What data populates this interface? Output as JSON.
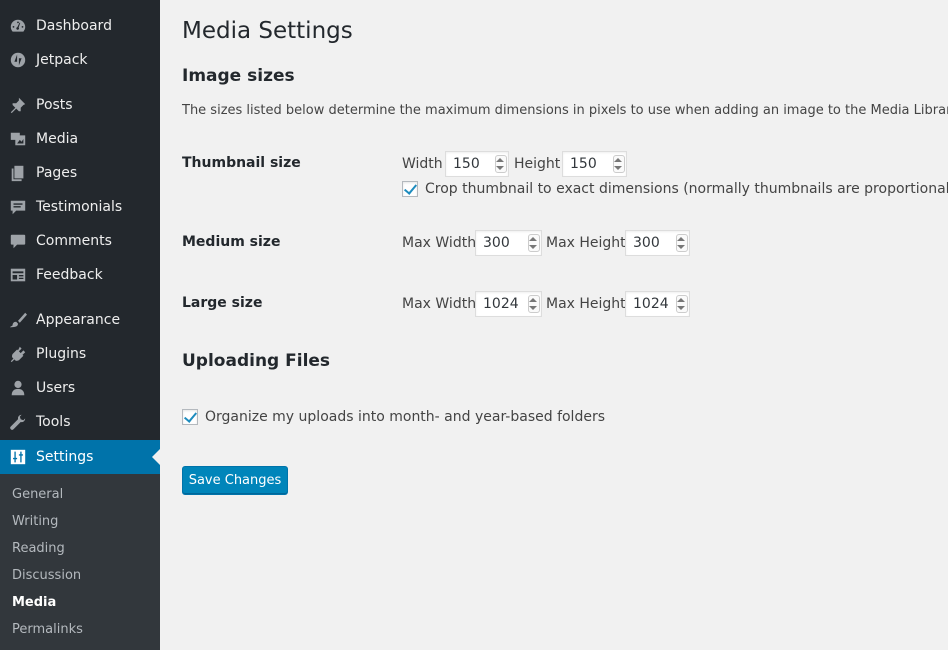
{
  "sidebar": {
    "items": [
      {
        "label": "Dashboard",
        "icon": "dashboard-icon"
      },
      {
        "label": "Jetpack",
        "icon": "jetpack-icon"
      },
      {
        "label": "Posts",
        "icon": "pushpin-icon"
      },
      {
        "label": "Media",
        "icon": "media-icon"
      },
      {
        "label": "Pages",
        "icon": "pages-icon"
      },
      {
        "label": "Testimonials",
        "icon": "testimonials-icon"
      },
      {
        "label": "Comments",
        "icon": "comment-bubble-icon"
      },
      {
        "label": "Feedback",
        "icon": "feedback-icon"
      },
      {
        "label": "Appearance",
        "icon": "paintbrush-icon"
      },
      {
        "label": "Plugins",
        "icon": "plug-icon"
      },
      {
        "label": "Users",
        "icon": "user-icon"
      },
      {
        "label": "Tools",
        "icon": "wrench-icon"
      },
      {
        "label": "Settings",
        "icon": "settings-sliders-icon",
        "active": true
      }
    ],
    "submenu": [
      {
        "label": "General"
      },
      {
        "label": "Writing"
      },
      {
        "label": "Reading"
      },
      {
        "label": "Discussion"
      },
      {
        "label": "Media",
        "current": true
      },
      {
        "label": "Permalinks"
      }
    ]
  },
  "main": {
    "title": "Media Settings",
    "image_sizes": {
      "heading": "Image sizes",
      "description": "The sizes listed below determine the maximum dimensions in pixels to use when adding an image to the Media Library.",
      "thumbnail": {
        "label": "Thumbnail size",
        "width_label": "Width",
        "width_value": "150",
        "height_label": "Height",
        "height_value": "150",
        "crop_label": "Crop thumbnail to exact dimensions (normally thumbnails are proportional)",
        "crop_checked": true
      },
      "medium": {
        "label": "Medium size",
        "width_label": "Max Width",
        "width_value": "300",
        "height_label": "Max Height",
        "height_value": "300"
      },
      "large": {
        "label": "Large size",
        "width_label": "Max Width",
        "width_value": "1024",
        "height_label": "Max Height",
        "height_value": "1024"
      }
    },
    "uploading": {
      "heading": "Uploading Files",
      "organize_label": "Organize my uploads into month- and year-based folders",
      "organize_checked": true
    },
    "save_label": "Save Changes"
  },
  "colors": {
    "sidebar_bg": "#23282d",
    "submenu_bg": "#32373c",
    "accent": "#0073aa",
    "button": "#0085ba",
    "page_bg": "#f1f1f1"
  }
}
